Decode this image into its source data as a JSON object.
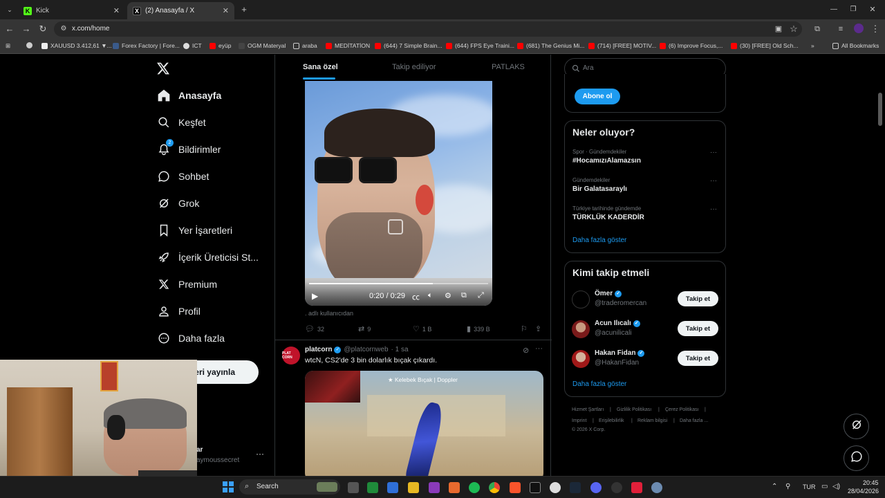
{
  "browser": {
    "tabs": [
      {
        "title": "Kick",
        "active": false
      },
      {
        "title": "(2) Anasayfa / X",
        "active": true
      }
    ],
    "url": "x.com/home",
    "bookmarks": [
      "XAUUSD 3.412,61 ▼...",
      "Forex Factory | Fore...",
      "ICT",
      "eyüp",
      "OGM Materyal",
      "araba",
      "MEDİTATİON",
      "(644) 7 Simple Brain...",
      "(644) FPS Eye Traini...",
      "(681) The Genius Mi...",
      "(714) [FREE] MOTIV...",
      "(6) Improve Focus,...",
      "(30) [FREE] Old Sch...",
      "All Bookmarks"
    ]
  },
  "sidebar": {
    "items": [
      {
        "label": "Anasayfa",
        "icon": "home-icon",
        "active": true
      },
      {
        "label": "Keşfet",
        "icon": "search-icon"
      },
      {
        "label": "Bildirimler",
        "icon": "bell-icon",
        "badge": "2"
      },
      {
        "label": "Sohbet",
        "icon": "chat-icon"
      },
      {
        "label": "Grok",
        "icon": "grok-icon"
      },
      {
        "label": "Yer İşaretleri",
        "icon": "bookmark-icon"
      },
      {
        "label": "İçerik Üreticisi St...",
        "icon": "rocket-icon"
      },
      {
        "label": "Premium",
        "icon": "x-logo-icon"
      },
      {
        "label": "Profil",
        "icon": "person-icon"
      },
      {
        "label": "Daha fazla",
        "icon": "more-circle-icon"
      }
    ],
    "post_button": "eri yayınla",
    "account_name": "ar",
    "account_handle": "aymoussecret"
  },
  "feed": {
    "tabs": [
      "Sana özel",
      "Takip ediliyor",
      "PATLAKS"
    ],
    "video": {
      "time": "0:20 / 0:29",
      "progress": 0.69,
      "caption": ". adlı kullanıcıdan"
    },
    "tweet1_actions": {
      "replies": "32",
      "reposts": "9",
      "likes": "1 B",
      "views": "339 B"
    },
    "tweet2": {
      "name": "platcorn",
      "handle": "@platcornweb",
      "time": "· 1 sa",
      "text": "wtcN, CS2'de 3 bin dolarlık bıçak çıkardı.",
      "image_caption": "★ Kelebek Bıçak | Doppler",
      "avatar_text": "PLAT CORN"
    }
  },
  "right": {
    "search_placeholder": "Ara",
    "subscribe": "Abone ol",
    "trends_title": "Neler oluyor?",
    "trends": [
      {
        "meta": "Spor · Gündemdekiler",
        "name": "#HocamızıAlamazsın"
      },
      {
        "meta": "Gündemdekiler",
        "name": "Bir Galatasaraylı"
      },
      {
        "meta": "Türkiye tarihinde gündemde",
        "name": "TÜRKLÜK KADERDİR"
      }
    ],
    "trends_more": "Daha fazla göster",
    "who_title": "Kimi takip etmeli",
    "who": [
      {
        "name": "Ömer",
        "handle": "@traderomercan",
        "button": "Takip et"
      },
      {
        "name": "Acun Ilıcalı",
        "handle": "@acunilicali",
        "button": "Takip et"
      },
      {
        "name": "Hakan Fidan",
        "handle": "@HakanFidan",
        "button": "Takip et"
      }
    ],
    "who_more": "Daha fazla göster",
    "footer": [
      "Hizmet Şartları",
      "|",
      "Gizlilik Politikası",
      "|",
      "Çerez Politikası",
      "|",
      "Imprint",
      "|",
      "Erişilebilirlik",
      "|",
      "Reklam bilgisi",
      "|",
      "Daha fazla ...",
      "© 2026 X Corp."
    ]
  },
  "taskbar": {
    "search": "Search",
    "lang": "TUR",
    "time": "20:45",
    "date": "28/04/2026"
  },
  "colors": {
    "accent": "#1d9bf0",
    "background": "#000000",
    "border": "#2f3336"
  }
}
